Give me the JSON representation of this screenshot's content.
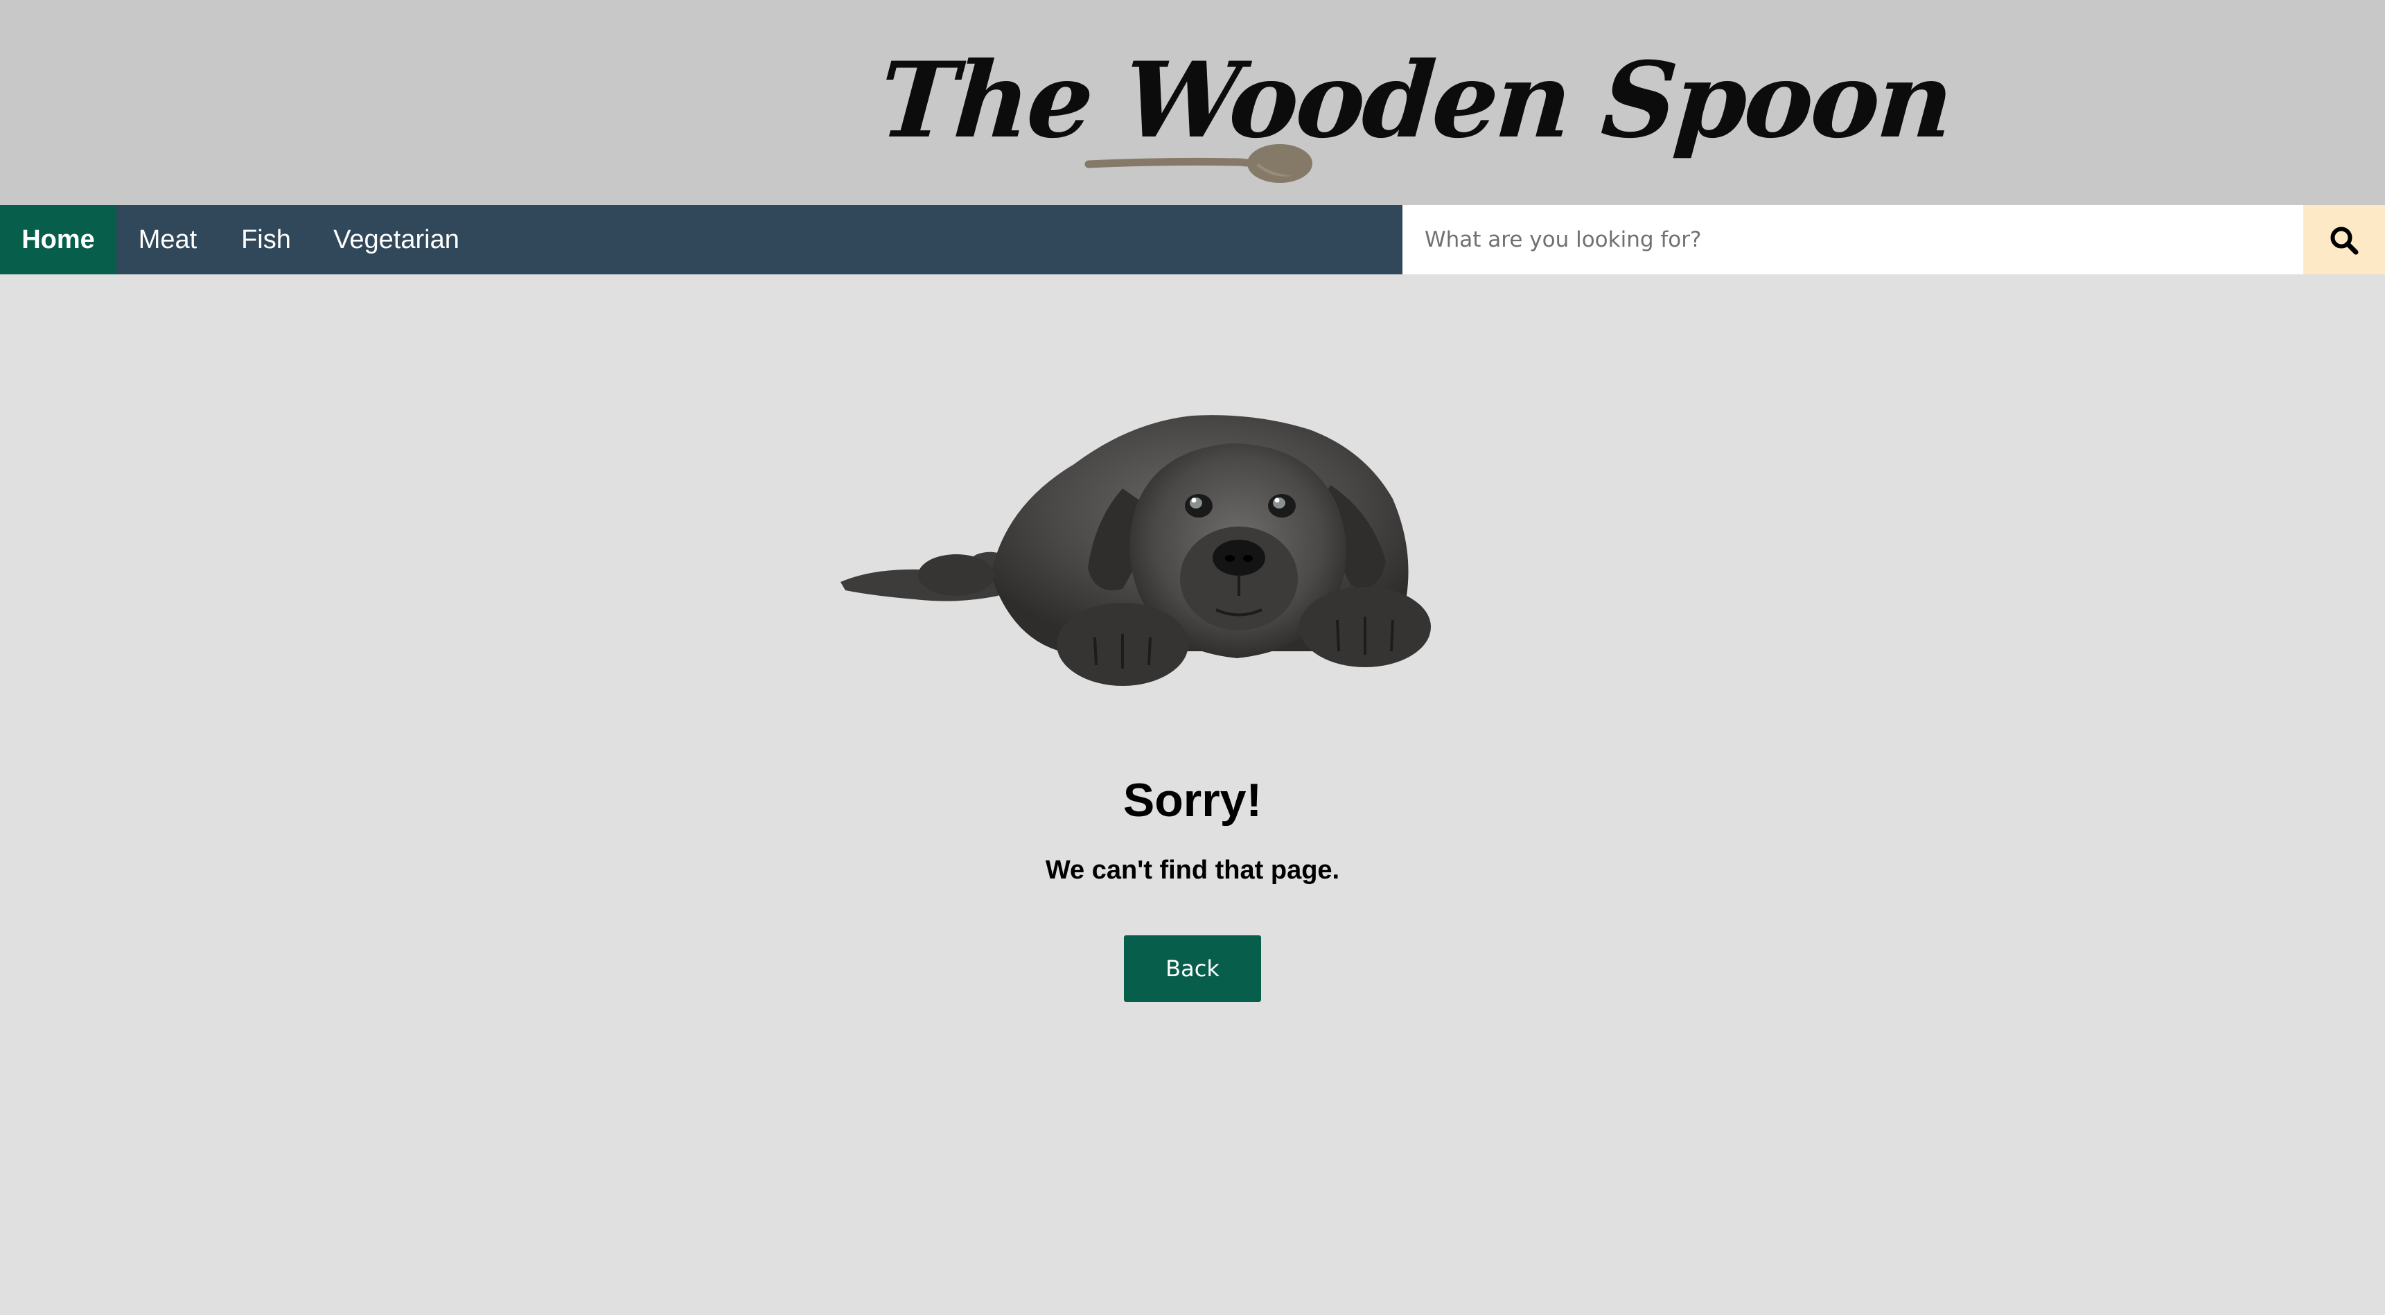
{
  "header": {
    "logo_text": "The Wooden Spoon"
  },
  "nav": {
    "items": [
      {
        "label": "Home",
        "active": true
      },
      {
        "label": "Meat",
        "active": false
      },
      {
        "label": "Fish",
        "active": false
      },
      {
        "label": "Vegetarian",
        "active": false
      }
    ]
  },
  "search": {
    "placeholder": "What are you looking for?",
    "value": "",
    "icon": "search-icon"
  },
  "main": {
    "image": "sad-puppy-illustration",
    "title": "Sorry!",
    "message": "We can't find that page.",
    "back_label": "Back"
  },
  "colors": {
    "header_bg": "#c8c8c8",
    "nav_bg": "#304859",
    "accent_green": "#065e4b",
    "search_button_bg": "#fde9c6",
    "page_bg": "#e0e0e0",
    "spoon": "#857a68"
  }
}
